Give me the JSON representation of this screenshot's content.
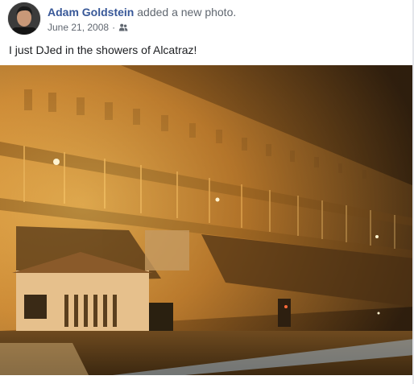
{
  "post": {
    "author": {
      "name": "Adam Goldstein",
      "action": " added a new photo."
    },
    "date": "June 21, 2008",
    "separator": " · ",
    "audience_icon": "friends-icon",
    "caption": "I just DJed in the showers of Alcatraz!",
    "photo_subject": "night-building-photo"
  },
  "colors": {
    "author_link": "#385898",
    "meta_text": "#606770",
    "photo_glow": "#f2a63a"
  }
}
